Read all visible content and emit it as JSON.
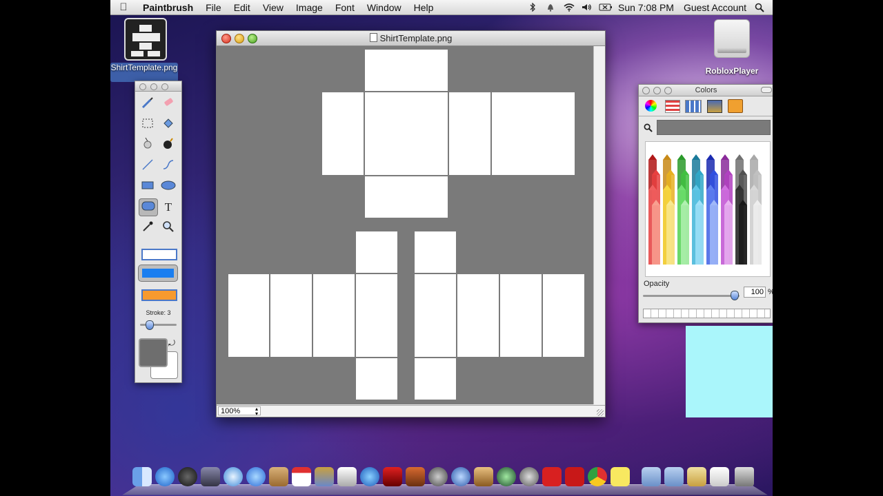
{
  "menubar": {
    "app_name": "Paintbrush",
    "menus": [
      "File",
      "Edit",
      "View",
      "Image",
      "Font",
      "Window",
      "Help"
    ],
    "clock": "Sun 7:08 PM",
    "user": "Guest Account"
  },
  "desktop": {
    "file_icon_label": "ShirtTemplate.png",
    "drive_label": "RobloxPlayer"
  },
  "document_window": {
    "title": "ShirtTemplate.png",
    "zoom": "100%"
  },
  "tool_palette": {
    "stroke_label": "Stroke: 3",
    "stroke_value": 3,
    "fill_color": "#6e6e6e",
    "background_color": "#ffffff"
  },
  "colors_panel": {
    "title": "Colors",
    "opacity_label": "Opacity",
    "opacity_value": "100",
    "opacity_unit": "%",
    "search_value": ""
  },
  "colors": {
    "canvas_bg": "#7a7a7a",
    "panel": "#ffffff",
    "sticky_note": "#aaf6fb"
  },
  "crayons": [
    "#a01818",
    "#b8861a",
    "#2a8a2a",
    "#1a6a8a",
    "#1a2aa0",
    "#8a2a8a",
    "#707070",
    "#9a9a9a"
  ]
}
